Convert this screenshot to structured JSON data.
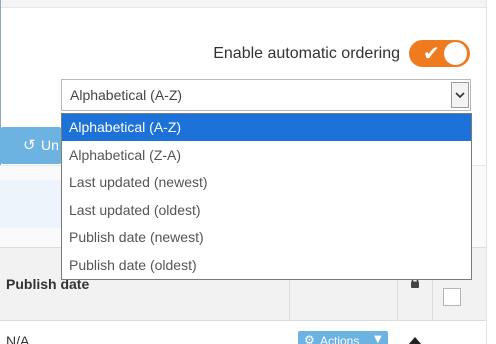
{
  "ordering": {
    "label": "Enable automatic ordering",
    "enabled": true,
    "toggle_check_glyph": "✔"
  },
  "sort_select": {
    "value": "Alphabetical (A-Z)",
    "options": [
      "Alphabetical (A-Z)",
      "Alphabetical (Z-A)",
      "Last updated (newest)",
      "Last updated (oldest)",
      "Publish date (newest)",
      "Publish date (oldest)"
    ],
    "selected_index": 0
  },
  "toolbar": {
    "undo_label": "Un",
    "undo_icon": "undo-icon"
  },
  "table": {
    "header_publish_date": "Publish date",
    "lock_icon": "lock-icon",
    "rows": [
      {
        "publish_date": "N/A",
        "actions_label": "Actions",
        "actions_icon": "gear-icon",
        "move_icon": "arrow-up-icon"
      }
    ]
  },
  "colors": {
    "accent_orange": "#f07b1e",
    "selection_blue": "#1c72d9",
    "button_blue": "#6cb3e2"
  }
}
